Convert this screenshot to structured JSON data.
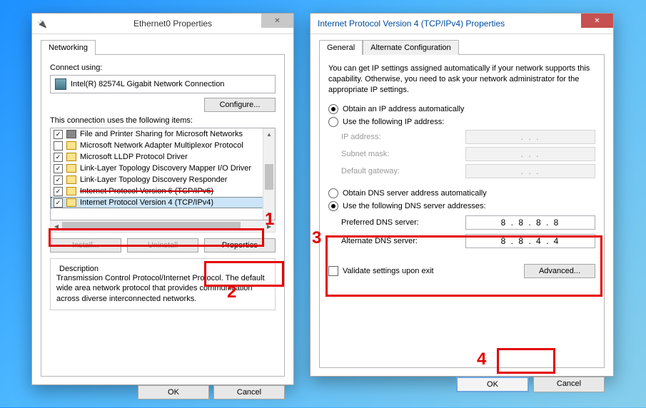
{
  "window1": {
    "title": "Ethernet0 Properties",
    "tabs": {
      "networking": "Networking"
    },
    "connect_using_label": "Connect using:",
    "adapter_name": "Intel(R) 82574L Gigabit Network Connection",
    "configure_btn": "Configure...",
    "items_label": "This connection uses the following items:",
    "items": [
      {
        "checked": true,
        "label": "File and Printer Sharing for Microsoft Networks"
      },
      {
        "checked": false,
        "label": "Microsoft Network Adapter Multiplexor Protocol"
      },
      {
        "checked": true,
        "label": "Microsoft LLDP Protocol Driver"
      },
      {
        "checked": true,
        "label": "Link-Layer Topology Discovery Mapper I/O Driver"
      },
      {
        "checked": true,
        "label": "Link-Layer Topology Discovery Responder"
      },
      {
        "checked": true,
        "label": "Internet Protocol Version 6 (TCP/IPv6)",
        "struck": true
      },
      {
        "checked": true,
        "label": "Internet Protocol Version 4 (TCP/IPv4)",
        "selected": true
      }
    ],
    "install_btn": "Install...",
    "uninstall_btn": "Uninstall",
    "properties_btn": "Properties",
    "description_label": "Description",
    "description_text": "Transmission Control Protocol/Internet Protocol. The default wide area network protocol that provides communication across diverse interconnected networks.",
    "ok_btn": "OK",
    "cancel_btn": "Cancel"
  },
  "window2": {
    "title": "Internet Protocol Version 4 (TCP/IPv4) Properties",
    "tabs": {
      "general": "General",
      "alt": "Alternate Configuration"
    },
    "intro": "You can get IP settings assigned automatically if your network supports this capability. Otherwise, you need to ask your network administrator for the appropriate IP settings.",
    "radio_ip_auto": "Obtain an IP address automatically",
    "radio_ip_manual": "Use the following IP address:",
    "ip_label": "IP address:",
    "subnet_label": "Subnet mask:",
    "gateway_label": "Default gateway:",
    "radio_dns_auto": "Obtain DNS server address automatically",
    "radio_dns_manual": "Use the following DNS server addresses:",
    "pref_dns_label": "Preferred DNS server:",
    "alt_dns_label": "Alternate DNS server:",
    "pref_dns_value": "8 . 8 . 8 . 8",
    "alt_dns_value": "8 . 8 . 4 . 4",
    "validate_label": "Validate settings upon exit",
    "advanced_btn": "Advanced...",
    "ok_btn": "OK",
    "cancel_btn": "Cancel"
  },
  "annotations": {
    "n1": "1",
    "n2": "2",
    "n3": "3",
    "n4": "4"
  },
  "dots": ".       .       ."
}
